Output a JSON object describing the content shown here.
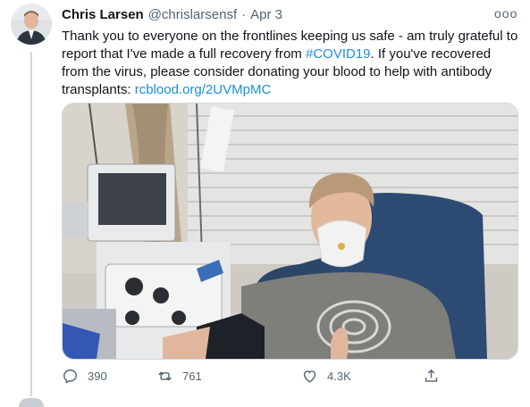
{
  "tweet": {
    "author_name": "Chris Larsen",
    "author_handle": "@chrislarsensf",
    "separator": "·",
    "date": "Apr 3",
    "more_label": "ooo",
    "text_before_hashtag": "Thank you to everyone on the frontlines keeping us safe - am truly grateful to report that I've made a full recovery from ",
    "hashtag": "#COVID19",
    "text_after_hashtag": ". If you've recovered from the virus, please consider donating your blood to help with antibody transplants: ",
    "link_text": "rcblood.org/2UVMpMC"
  },
  "actions": {
    "reply_count": "390",
    "retweet_count": "761",
    "like_count": "4.3K"
  },
  "icons": {
    "reply": "reply-icon",
    "retweet": "retweet-icon",
    "like": "heart-icon",
    "share": "share-icon",
    "more": "more-icon"
  },
  "colors": {
    "link": "#1b8fe0",
    "secondary_text": "#536471",
    "primary_text": "#0f1419"
  }
}
